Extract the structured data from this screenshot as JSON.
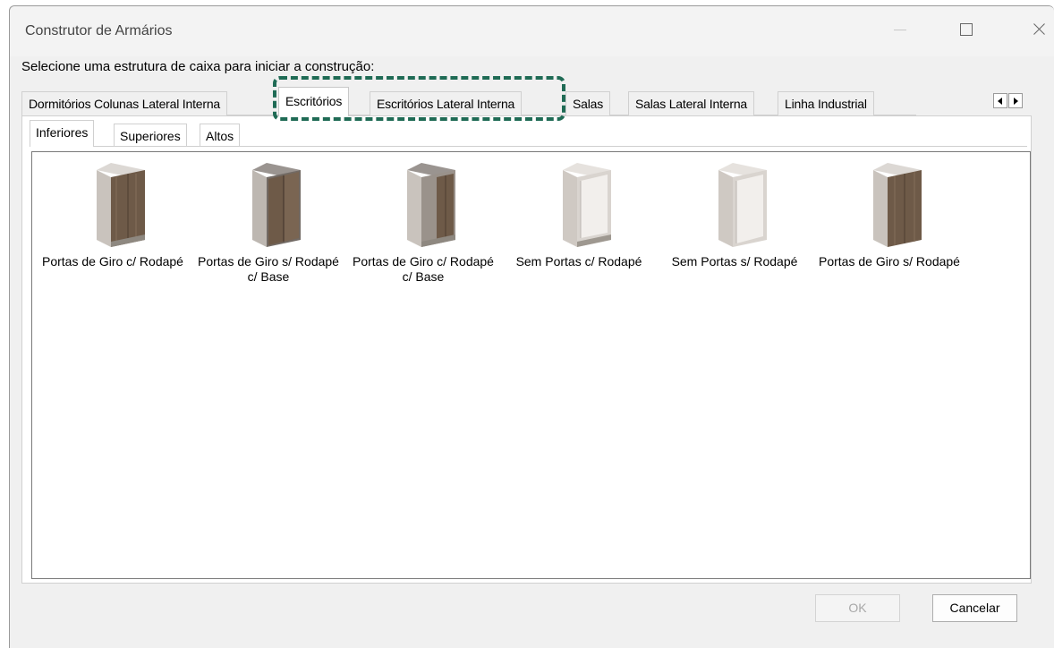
{
  "window": {
    "title": "Construtor de Armários"
  },
  "instruction": "Selecione uma estrutura de caixa para iniciar a construção:",
  "tabs": [
    {
      "label": "Dormitórios Colunas Lateral Interna"
    },
    {
      "label": "Escritórios"
    },
    {
      "label": "Escritórios Lateral Interna"
    },
    {
      "label": "Salas"
    },
    {
      "label": "Salas Lateral Interna"
    },
    {
      "label": "Linha Industrial"
    }
  ],
  "active_tab": "Escritórios",
  "subtabs": [
    {
      "label": "Inferiores"
    },
    {
      "label": "Superiores"
    },
    {
      "label": "Altos"
    }
  ],
  "active_subtab": "Inferiores",
  "items": [
    {
      "label": "Portas de Giro c/ Rodapé",
      "icon": "cabinet-wood-doors-icon"
    },
    {
      "label": "Portas de Giro s/ Rodapé c/ Base",
      "icon": "cabinet-gray-doors-icon"
    },
    {
      "label": "Portas de Giro c/ Rodapé c/ Base",
      "icon": "cabinet-wood-doors-base-icon"
    },
    {
      "label": "Sem Portas c/ Rodapé",
      "icon": "cabinet-open-icon"
    },
    {
      "label": "Sem Portas s/ Rodapé",
      "icon": "cabinet-open-no-plinth-icon"
    },
    {
      "label": "Portas de Giro s/ Rodapé",
      "icon": "cabinet-wood-doors-no-plinth-icon"
    }
  ],
  "buttons": {
    "ok": "OK",
    "cancel": "Cancelar"
  },
  "colors": {
    "highlight": "#1f6b55",
    "wood": "#6e5a48",
    "carcass": "#c9c3bd"
  }
}
